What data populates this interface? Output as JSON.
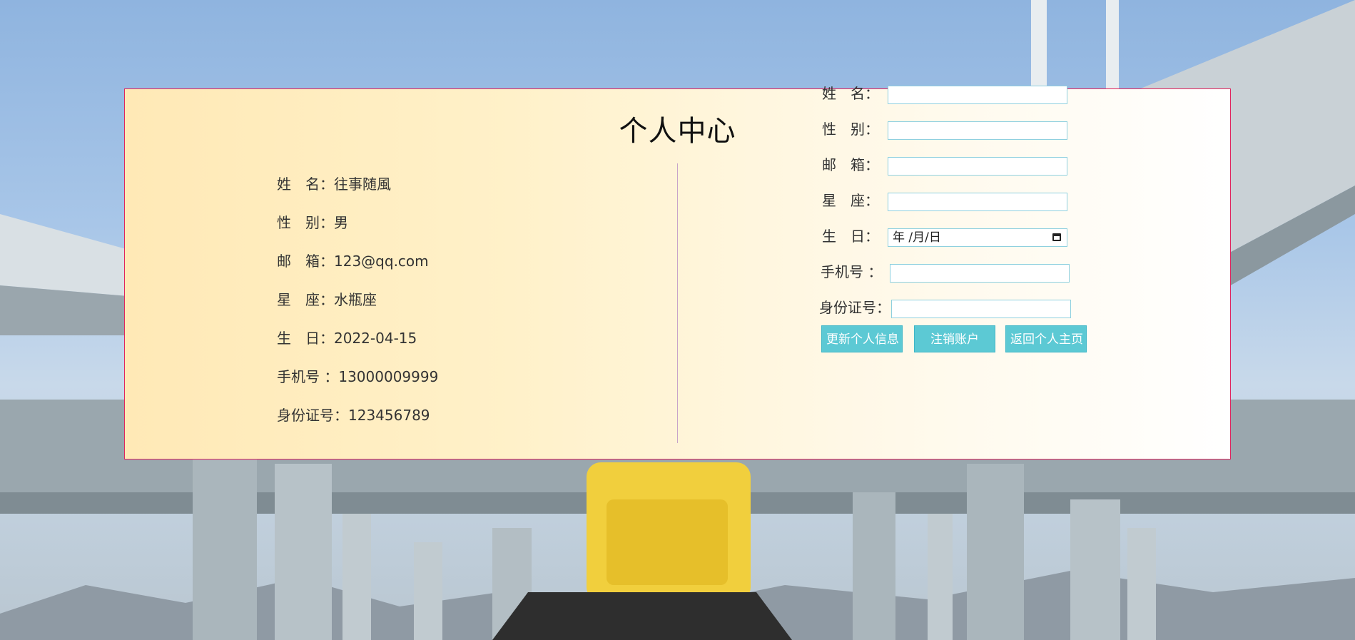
{
  "page": {
    "title": "个人中心"
  },
  "profile": {
    "rows": [
      {
        "label": "姓　名：",
        "value": "往事随風"
      },
      {
        "label": "性　别：",
        "value": "男"
      },
      {
        "label": "邮　箱：",
        "value": "123@qq.com"
      },
      {
        "label": "星　座：",
        "value": "水瓶座"
      },
      {
        "label": "生　日：",
        "value": "2022-04-15"
      },
      {
        "label": "手机号 ：",
        "value": "13000009999"
      },
      {
        "label": "身份证号：",
        "value": "123456789"
      }
    ]
  },
  "form": {
    "name_label": "姓　名：",
    "gender_label": "性　别：",
    "email_label": "邮　箱：",
    "zodiac_label": "星　座：",
    "birthday_label": "生　日：",
    "birthday_value": "年 /月/日",
    "phone_label": "手机号 ：",
    "id_label": "身份证号：",
    "name_value": "",
    "gender_value": "",
    "email_value": "",
    "zodiac_value": "",
    "phone_value": "",
    "id_value": ""
  },
  "actions": {
    "update_label": "更新个人信息",
    "cancel_label": "注销账户",
    "home_label": "返回个人主页"
  },
  "colors": {
    "card_border": "#e0245e",
    "button_bg": "#5cc9d4",
    "input_border": "#8fd0df",
    "divider": "#c9a3c9"
  },
  "icons": {
    "calendar": "calendar-icon"
  }
}
